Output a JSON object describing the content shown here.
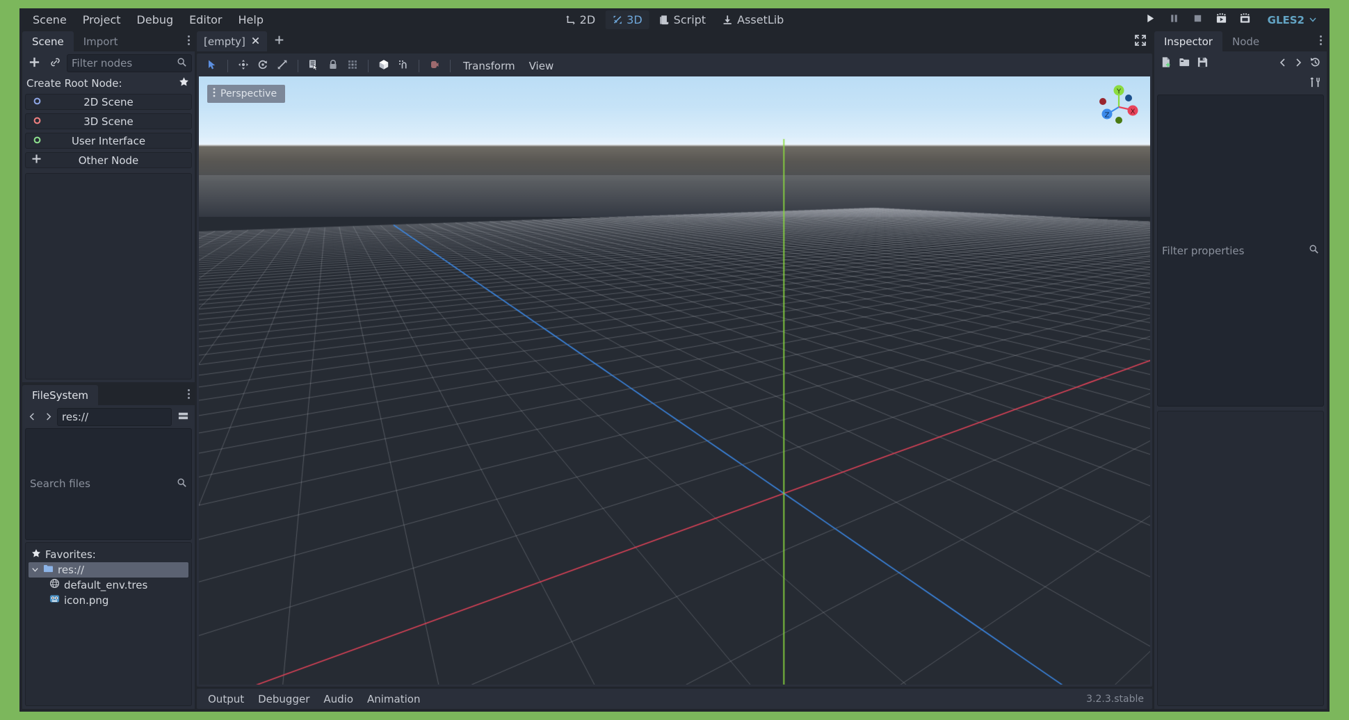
{
  "window": {
    "border_color": "#7CB75C",
    "background": "#21252C",
    "accent_color": "#6FA8DC"
  },
  "menubar": {
    "items": [
      {
        "label": "Scene"
      },
      {
        "label": "Project"
      },
      {
        "label": "Debug"
      },
      {
        "label": "Editor"
      },
      {
        "label": "Help"
      }
    ],
    "main_tabs": [
      {
        "label": "2D",
        "icon": "move-2d-icon",
        "active": false
      },
      {
        "label": "3D",
        "icon": "move-3d-icon",
        "active": true
      },
      {
        "label": "Script",
        "icon": "script-icon",
        "active": false
      },
      {
        "label": "AssetLib",
        "icon": "download-icon",
        "active": false
      }
    ],
    "run_controls": [
      {
        "name": "play-button",
        "icon": "play-icon"
      },
      {
        "name": "pause-button",
        "icon": "pause-icon"
      },
      {
        "name": "stop-button",
        "icon": "stop-icon"
      },
      {
        "name": "play-scene-button",
        "icon": "play-scene-icon"
      },
      {
        "name": "play-custom-scene-button",
        "icon": "play-custom-icon"
      }
    ],
    "renderer": {
      "label": "GLES2",
      "color": "#63A4C4"
    }
  },
  "scene_dock": {
    "tabs": [
      {
        "label": "Scene",
        "active": true
      },
      {
        "label": "Import",
        "active": false
      }
    ],
    "toolbar": {
      "add_node_icon": "plus-icon",
      "instance_scene_icon": "link-icon",
      "filter_placeholder": "Filter nodes",
      "search_icon": "search-icon"
    },
    "create_root": {
      "title": "Create Root Node:",
      "favorite_icon": "star-icon",
      "options": [
        {
          "label": "2D Scene",
          "icon": "node2d-icon",
          "color": "#8DA5E3"
        },
        {
          "label": "3D Scene",
          "icon": "spatial-icon",
          "color": "#F08080"
        },
        {
          "label": "User Interface",
          "icon": "control-icon",
          "color": "#8DE08D"
        },
        {
          "label": "Other Node",
          "icon": "plus-icon",
          "color": "#C9CDD4"
        }
      ]
    }
  },
  "filesystem_dock": {
    "title": "FileSystem",
    "nav": {
      "back_icon": "chevron-left-icon",
      "forward_icon": "chevron-right-icon",
      "path": "res://",
      "split_mode_icon": "split-mode-icon"
    },
    "search_placeholder": "Search files",
    "search_icon": "search-icon",
    "tree": [
      {
        "label": "Favorites:",
        "icon": "star-icon",
        "indent": 1,
        "selected": false
      },
      {
        "label": "res://",
        "icon": "folder-icon",
        "indent": 1,
        "selected": true,
        "expander": "chevron-down-icon"
      },
      {
        "label": "default_env.tres",
        "icon": "environment-icon",
        "indent": 2,
        "selected": false
      },
      {
        "label": "icon.png",
        "icon": "godot-icon",
        "indent": 2,
        "selected": false
      }
    ]
  },
  "scene_tabs": {
    "tabs": [
      {
        "label": "[empty]",
        "active": true,
        "close_icon": "close-icon"
      }
    ],
    "add_tab_icon": "plus-icon",
    "distraction_free_icon": "expand-icon"
  },
  "viewport_toolbar": {
    "tools": [
      {
        "name": "select-mode-button",
        "icon": "cursor-icon",
        "active": true
      },
      {
        "name": "move-mode-button",
        "icon": "move-icon",
        "active": false
      },
      {
        "name": "rotate-mode-button",
        "icon": "rotate-icon",
        "active": false
      },
      {
        "name": "scale-mode-button",
        "icon": "scale-icon",
        "active": false
      },
      {
        "name": "list-select-button",
        "icon": "list-select-icon",
        "active": false
      },
      {
        "name": "lock-button",
        "icon": "lock-icon",
        "active": false
      },
      {
        "name": "group-button",
        "icon": "group-icon",
        "active": false
      },
      {
        "name": "local-space-button",
        "icon": "local-space-icon",
        "active": false
      },
      {
        "name": "snap-button",
        "icon": "snap-icon",
        "active": false
      },
      {
        "name": "camera-preview-button",
        "icon": "camera-icon",
        "active": false
      }
    ],
    "menus": [
      {
        "label": "Transform"
      },
      {
        "label": "View"
      }
    ]
  },
  "viewport": {
    "perspective_label": "Perspective",
    "view_menu_icon": "dots-vertical-icon",
    "gizmo": {
      "axes": [
        {
          "label": "X",
          "color": "#FC4549"
        },
        {
          "label": "Y",
          "color": "#8BDB3F"
        },
        {
          "label": "Z",
          "color": "#3C8BEB"
        }
      ]
    },
    "colors": {
      "sky_top": "#BBDDF5",
      "sky_bottom": "#E9F3FC",
      "ground": "#262B33",
      "grid": "#C8CBD0",
      "x_axis": "#E8435A",
      "y_axis": "#8BDB3F",
      "z_axis": "#3C8BEB"
    }
  },
  "bottom_panel": {
    "tabs": [
      {
        "label": "Output"
      },
      {
        "label": "Debugger"
      },
      {
        "label": "Audio"
      },
      {
        "label": "Animation"
      }
    ],
    "version": "3.2.3.stable"
  },
  "inspector_dock": {
    "tabs": [
      {
        "label": "Inspector",
        "active": true
      },
      {
        "label": "Node",
        "active": false
      }
    ],
    "toolbar": [
      {
        "name": "new-resource-button",
        "icon": "new-resource-icon"
      },
      {
        "name": "load-resource-button",
        "icon": "folder-open-icon"
      },
      {
        "name": "save-resource-button",
        "icon": "save-icon"
      },
      {
        "name": "history-prev-button",
        "icon": "chevron-left-icon"
      },
      {
        "name": "history-next-button",
        "icon": "chevron-right-icon"
      },
      {
        "name": "history-button",
        "icon": "history-icon"
      },
      {
        "name": "object-menu-button",
        "icon": "tools-icon"
      }
    ],
    "filter_placeholder": "Filter properties",
    "search_icon": "search-icon"
  }
}
